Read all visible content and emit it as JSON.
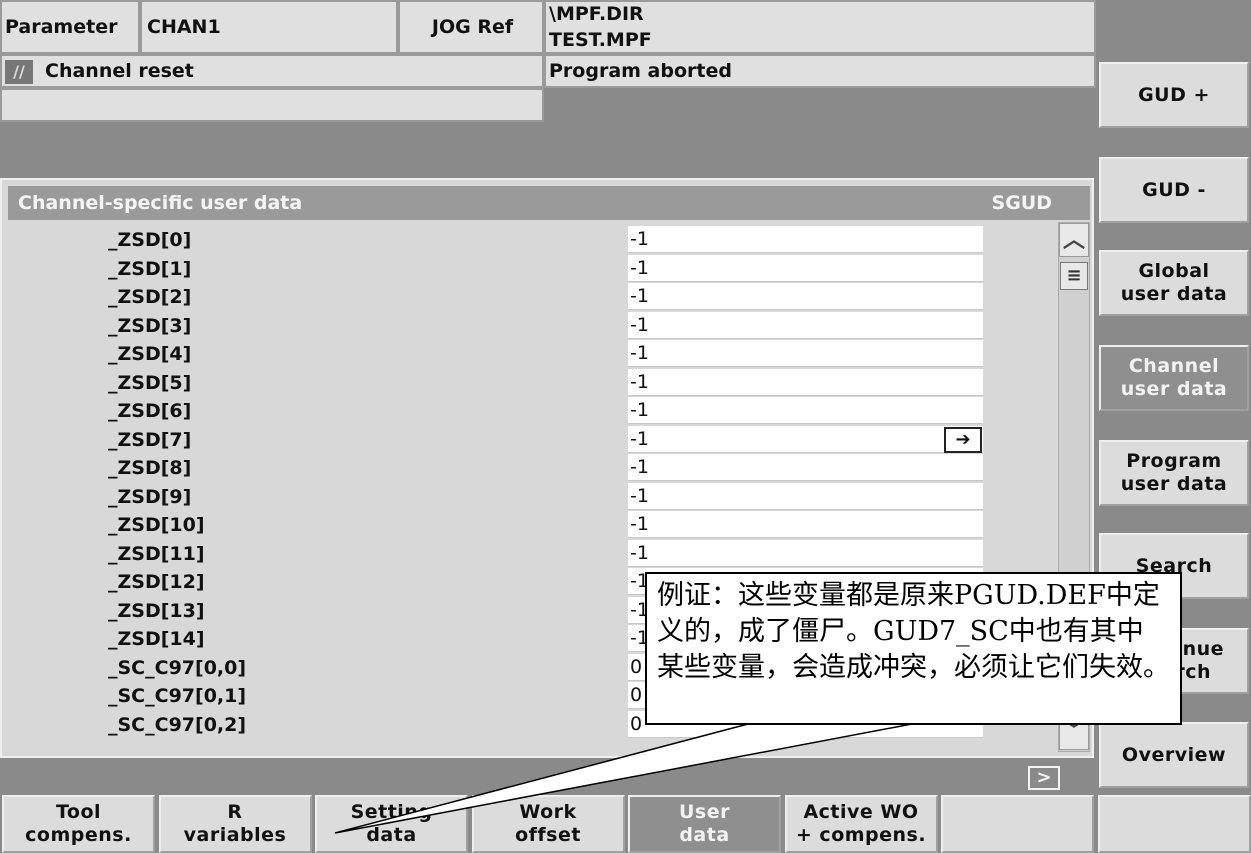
{
  "header": {
    "area": "Parameter",
    "channel": "CHAN1",
    "mode": "JOG Ref",
    "path_dir": "\\MPF.DIR",
    "program": "TEST.MPF",
    "channel_status": "Channel reset",
    "program_status": "Program aborted"
  },
  "panel": {
    "title": "Channel-specific user data",
    "type": "SGUD"
  },
  "rows": [
    {
      "name": "_ZSD[0]",
      "value": "-1"
    },
    {
      "name": "_ZSD[1]",
      "value": "-1"
    },
    {
      "name": "_ZSD[2]",
      "value": "-1"
    },
    {
      "name": "_ZSD[3]",
      "value": "-1"
    },
    {
      "name": "_ZSD[4]",
      "value": "-1"
    },
    {
      "name": "_ZSD[5]",
      "value": "-1"
    },
    {
      "name": "_ZSD[6]",
      "value": "-1"
    },
    {
      "name": "_ZSD[7]",
      "value": "-1"
    },
    {
      "name": "_ZSD[8]",
      "value": "-1"
    },
    {
      "name": "_ZSD[9]",
      "value": "-1"
    },
    {
      "name": "_ZSD[10]",
      "value": "-1"
    },
    {
      "name": "_ZSD[11]",
      "value": "-1"
    },
    {
      "name": "_ZSD[12]",
      "value": "-1"
    },
    {
      "name": "_ZSD[13]",
      "value": "-1"
    },
    {
      "name": "_ZSD[14]",
      "value": "-1"
    },
    {
      "name": "_SC_C97[0,0]",
      "value": "0"
    },
    {
      "name": "_SC_C97[0,1]",
      "value": "0"
    },
    {
      "name": "_SC_C97[0,2]",
      "value": "0"
    }
  ],
  "vertical_softkeys": [
    {
      "label": "GUD +",
      "active": false
    },
    {
      "label": "GUD -",
      "active": false
    },
    {
      "label": "Global\nuser data",
      "active": false
    },
    {
      "label": "Channel\nuser data",
      "active": true
    },
    {
      "label": "Program\nuser data",
      "active": false
    },
    {
      "label": "Search",
      "active": false
    },
    {
      "label": "Continue\nsearch",
      "active": false
    },
    {
      "label": "Overview",
      "active": false
    }
  ],
  "horizontal_softkeys": [
    {
      "label": "Tool\ncompens.",
      "active": false
    },
    {
      "label": "R\nvariables",
      "active": false
    },
    {
      "label": "Setting\ndata",
      "active": false
    },
    {
      "label": "Work\noffset",
      "active": false
    },
    {
      "label": "User\ndata",
      "active": true
    },
    {
      "label": "Active WO\n+ compens.",
      "active": false
    },
    {
      "label": "",
      "active": false
    },
    {
      "label": "",
      "active": false
    }
  ],
  "callout": {
    "text": "例证：这些变量都是原来PGUD.DEF中定义的，成了僵尸。GUD7_SC中也有其中某些变量，会造成冲突，必须让它们失效。"
  }
}
